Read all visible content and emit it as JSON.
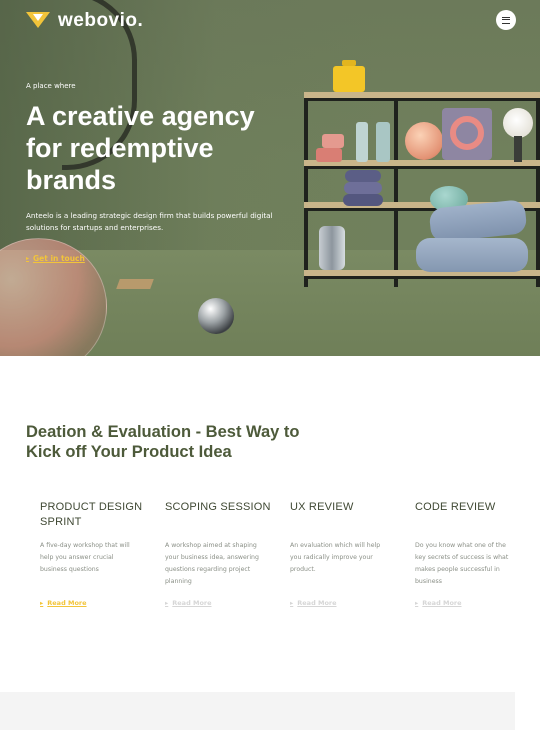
{
  "header": {
    "logo_text": "webovio.",
    "menu_icon": "hamburger-menu-icon"
  },
  "hero": {
    "eyebrow": "A place where",
    "title": "A creative agency for redemptive brands",
    "description": "Anteelo is a leading strategic design firm that builds powerful digital solutions for startups and enterprises.",
    "cta_label": "Get in touch"
  },
  "section": {
    "title": "Deation & Evaluation - Best Way to Kick off Your Product Idea"
  },
  "services": [
    {
      "name": "PRODUCT DESIGN SPRINT",
      "description": "A five-day workshop that will help you answer crucial business questions",
      "link": "Read More",
      "active": true
    },
    {
      "name": "SCOPING SESSION",
      "description": "A workshop aimed at shaping your business idea, answering questions regarding project planning",
      "link": "Read More",
      "active": false
    },
    {
      "name": "UX REVIEW",
      "description": "An evaluation which will help you radically improve your product.",
      "link": "Read More",
      "active": false
    },
    {
      "name": "CODE REVIEW",
      "description": "Do you know what one of the key secrets of success is what makes people successful in business",
      "link": "Read More",
      "active": false
    }
  ],
  "colors": {
    "accent": "#f2c43a",
    "hero_bg": "#71815b",
    "heading": "#4d5a3a"
  }
}
